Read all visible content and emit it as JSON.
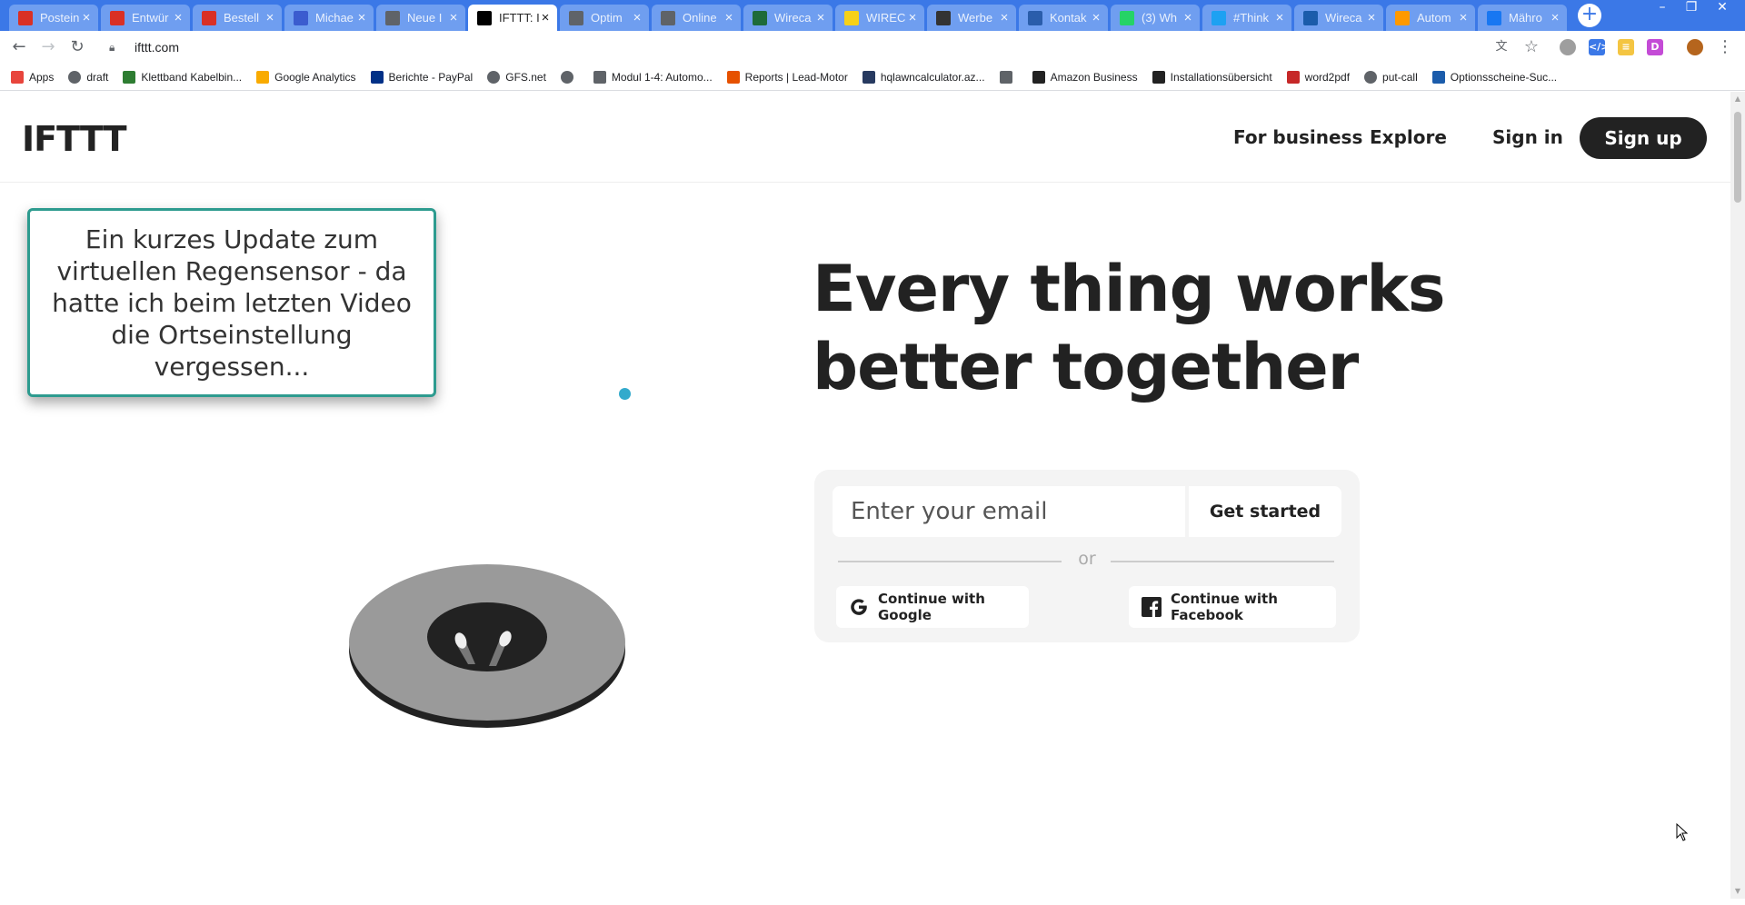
{
  "browser": {
    "tabs": [
      {
        "title": "Postein",
        "favicon": "gmail-icon",
        "color": "#d93025",
        "active": false
      },
      {
        "title": "Entwür",
        "favicon": "gmail-icon",
        "color": "#d93025",
        "active": false
      },
      {
        "title": "Bestell",
        "favicon": "gmail-icon",
        "color": "#d93025",
        "active": false
      },
      {
        "title": "Michae",
        "favicon": "doc-icon",
        "color": "#3b5ccf",
        "active": false
      },
      {
        "title": "Neue I",
        "favicon": "page-icon",
        "color": "#5f6368",
        "active": false
      },
      {
        "title": "IFTTT: I",
        "favicon": "ifttt-icon",
        "color": "#000000",
        "active": true
      },
      {
        "title": "Optim",
        "favicon": "page-icon",
        "color": "#5f6368",
        "active": false
      },
      {
        "title": "Online",
        "favicon": "page-icon",
        "color": "#5f6368",
        "active": false
      },
      {
        "title": "Wireca",
        "favicon": "wirecard-icon",
        "color": "#1e6b3a",
        "active": false
      },
      {
        "title": "WIREC",
        "favicon": "c-icon",
        "color": "#f7d117",
        "active": false
      },
      {
        "title": "Werbe",
        "favicon": "news-icon",
        "color": "#333333",
        "active": false
      },
      {
        "title": "Kontak",
        "favicon": "kontakt-icon",
        "color": "#2a5dab",
        "active": false
      },
      {
        "title": "(3) Wh",
        "favicon": "whatsapp-icon",
        "color": "#25d366",
        "active": false
      },
      {
        "title": "#Think",
        "favicon": "twitter-icon",
        "color": "#1da1f2",
        "active": false
      },
      {
        "title": "Wireca",
        "favicon": "ft-icon",
        "color": "#1b5cab",
        "active": false
      },
      {
        "title": "Autom",
        "favicon": "amazon-icon",
        "color": "#ff9900",
        "active": false
      },
      {
        "title": "Mähro",
        "favicon": "facebook-icon",
        "color": "#1877f2",
        "active": false
      }
    ],
    "url": "ifttt.com",
    "bookmarks": [
      {
        "label": "Apps",
        "icon": "apps-grid-icon"
      },
      {
        "label": "draft",
        "icon": "globe-icon"
      },
      {
        "label": "Klettband Kabelbin...",
        "icon": "leaf-icon"
      },
      {
        "label": "Google Analytics",
        "icon": "analytics-icon"
      },
      {
        "label": "Berichte - PayPal",
        "icon": "paypal-icon"
      },
      {
        "label": "GFS.net",
        "icon": "globe-icon"
      },
      {
        "label": "",
        "icon": "globe-icon"
      },
      {
        "label": "Modul 1-4: Automo...",
        "icon": "page-icon"
      },
      {
        "label": "Reports | Lead-Motor",
        "icon": "rocket-icon"
      },
      {
        "label": "hqlawncalculator.az...",
        "icon": "husqvarna-icon"
      },
      {
        "label": "",
        "icon": "page-icon"
      },
      {
        "label": "Amazon Business",
        "icon": "amazon-icon"
      },
      {
        "label": "Installationsübersicht",
        "icon": "fhem-icon"
      },
      {
        "label": "word2pdf",
        "icon": "pdf-icon"
      },
      {
        "label": "put-call",
        "icon": "globe-icon"
      },
      {
        "label": "Optionsscheine-Suc...",
        "icon": "ft-icon"
      }
    ]
  },
  "site": {
    "logo": "IFTTT",
    "nav": {
      "for_business": "For business",
      "explore": "Explore",
      "sign_in": "Sign in",
      "sign_up": "Sign up"
    },
    "hero_title": "Every thing works better together",
    "signup": {
      "email_placeholder": "Enter your email",
      "get_started": "Get started",
      "or": "or",
      "google": "Continue with Google",
      "facebook": "Continue with Facebook"
    }
  },
  "overlay_note": "Ein kurzes Update zum virtuellen Regensensor - da hatte ich beim letzten Video die Ortseinstellung vergessen..."
}
